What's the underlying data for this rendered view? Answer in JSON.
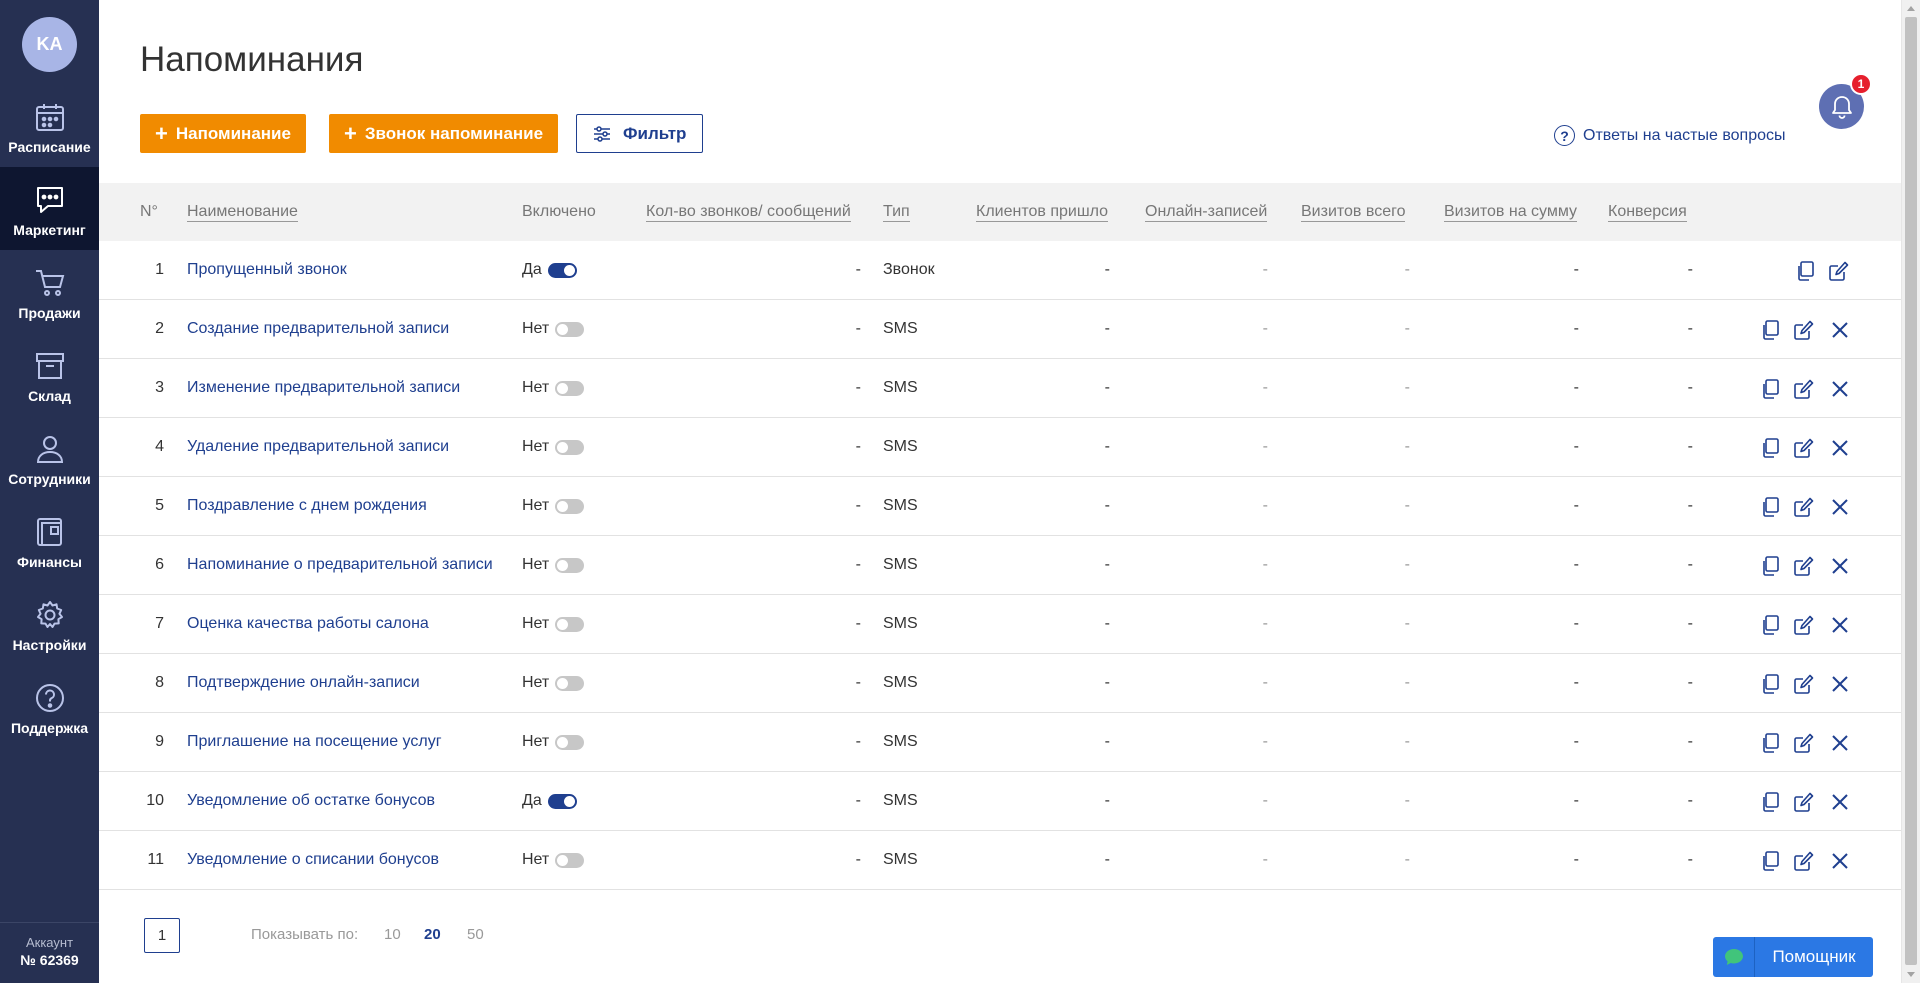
{
  "sidebar": {
    "avatar_initials": "KA",
    "items": [
      {
        "label": "Расписание",
        "icon": "calendar-icon"
      },
      {
        "label": "Маркетинг",
        "icon": "chat-icon"
      },
      {
        "label": "Продажи",
        "icon": "cart-icon"
      },
      {
        "label": "Склад",
        "icon": "box-icon"
      },
      {
        "label": "Сотрудники",
        "icon": "person-icon"
      },
      {
        "label": "Финансы",
        "icon": "wallet-icon"
      },
      {
        "label": "Настройки",
        "icon": "gear-icon"
      },
      {
        "label": "Поддержка",
        "icon": "help-icon"
      }
    ],
    "active_item": "Маркетинг",
    "account_label": "Аккаунт",
    "account_number": "№ 62369"
  },
  "header": {
    "title": "Напоминания",
    "btn_reminder": "Напоминание",
    "btn_call_reminder": "Звонок напоминание",
    "btn_filter": "Фильтр",
    "faq_label": "Ответы на частые вопросы",
    "notification_count": "1"
  },
  "table": {
    "columns": {
      "num": "N°",
      "name": "Наименование",
      "enabled": "Включено",
      "count": "Кол-во звонков/ сообщений",
      "type": "Тип",
      "clients": "Клиентов пришло",
      "online": "Онлайн-записей",
      "visits": "Визитов всего",
      "sum": "Визитов на сумму",
      "conversion": "Конверсия"
    },
    "rows": [
      {
        "num": "1",
        "name": "Пропущенный звонок",
        "enabled": "Да",
        "on": true,
        "count": "-",
        "type": "Звонок",
        "clients": "-",
        "online": "-",
        "visits": "-",
        "sum": "-",
        "conversion": "-"
      },
      {
        "num": "2",
        "name": "Создание предварительной записи",
        "enabled": "Нет",
        "on": false,
        "count": "-",
        "type": "SMS",
        "clients": "-",
        "online": "-",
        "visits": "-",
        "sum": "-",
        "conversion": "-"
      },
      {
        "num": "3",
        "name": "Изменение предварительной записи",
        "enabled": "Нет",
        "on": false,
        "count": "-",
        "type": "SMS",
        "clients": "-",
        "online": "-",
        "visits": "-",
        "sum": "-",
        "conversion": "-"
      },
      {
        "num": "4",
        "name": "Удаление предварительной записи",
        "enabled": "Нет",
        "on": false,
        "count": "-",
        "type": "SMS",
        "clients": "-",
        "online": "-",
        "visits": "-",
        "sum": "-",
        "conversion": "-"
      },
      {
        "num": "5",
        "name": "Поздравление с днем рождения",
        "enabled": "Нет",
        "on": false,
        "count": "-",
        "type": "SMS",
        "clients": "-",
        "online": "-",
        "visits": "-",
        "sum": "-",
        "conversion": "-"
      },
      {
        "num": "6",
        "name": "Напоминание о предварительной записи",
        "enabled": "Нет",
        "on": false,
        "count": "-",
        "type": "SMS",
        "clients": "-",
        "online": "-",
        "visits": "-",
        "sum": "-",
        "conversion": "-"
      },
      {
        "num": "7",
        "name": "Оценка качества работы салона",
        "enabled": "Нет",
        "on": false,
        "count": "-",
        "type": "SMS",
        "clients": "-",
        "online": "-",
        "visits": "-",
        "sum": "-",
        "conversion": "-"
      },
      {
        "num": "8",
        "name": "Подтверждение онлайн-записи",
        "enabled": "Нет",
        "on": false,
        "count": "-",
        "type": "SMS",
        "clients": "-",
        "online": "-",
        "visits": "-",
        "sum": "-",
        "conversion": "-"
      },
      {
        "num": "9",
        "name": "Приглашение на посещение услуг",
        "enabled": "Нет",
        "on": false,
        "count": "-",
        "type": "SMS",
        "clients": "-",
        "online": "-",
        "visits": "-",
        "sum": "-",
        "conversion": "-"
      },
      {
        "num": "10",
        "name": "Уведомление об остатке бонусов",
        "enabled": "Да",
        "on": true,
        "count": "-",
        "type": "SMS",
        "clients": "-",
        "online": "-",
        "visits": "-",
        "sum": "-",
        "conversion": "-"
      },
      {
        "num": "11",
        "name": "Уведомление о списании бонусов",
        "enabled": "Нет",
        "on": false,
        "count": "-",
        "type": "SMS",
        "clients": "-",
        "online": "-",
        "visits": "-",
        "sum": "-",
        "conversion": "-"
      }
    ]
  },
  "pagination": {
    "current_page": "1",
    "show_by_label": "Показывать по:",
    "options": [
      "10",
      "20",
      "50"
    ],
    "selected": "20"
  },
  "helper": {
    "label": "Помощник"
  },
  "colors": {
    "accent": "#f18b00",
    "brand": "#1f3f8f",
    "sidebar": "#263052"
  }
}
